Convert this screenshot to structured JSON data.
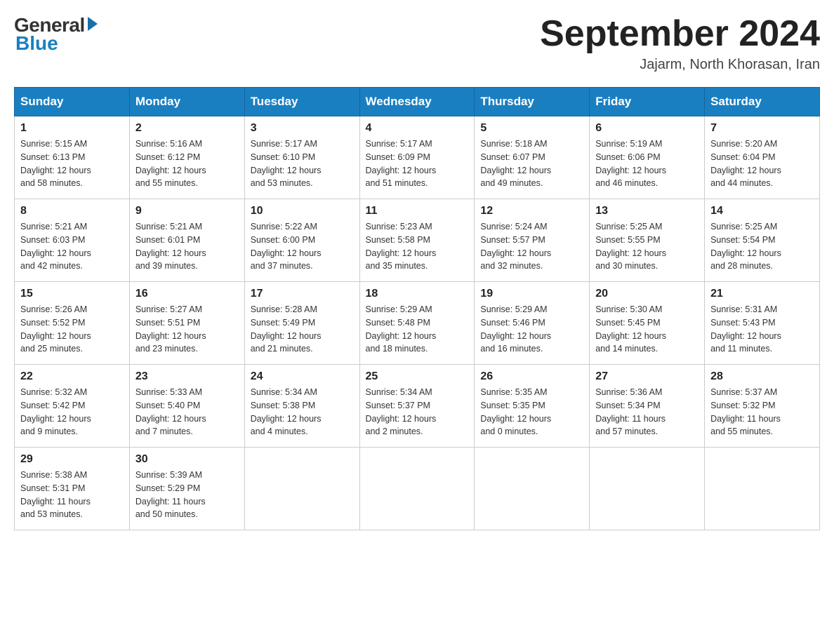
{
  "header": {
    "logo": {
      "general": "General",
      "blue": "Blue"
    },
    "title": "September 2024",
    "location": "Jajarm, North Khorasan, Iran"
  },
  "calendar": {
    "days_of_week": [
      "Sunday",
      "Monday",
      "Tuesday",
      "Wednesday",
      "Thursday",
      "Friday",
      "Saturday"
    ],
    "weeks": [
      [
        {
          "day": "1",
          "sunrise": "5:15 AM",
          "sunset": "6:13 PM",
          "daylight": "12 hours and 58 minutes."
        },
        {
          "day": "2",
          "sunrise": "5:16 AM",
          "sunset": "6:12 PM",
          "daylight": "12 hours and 55 minutes."
        },
        {
          "day": "3",
          "sunrise": "5:17 AM",
          "sunset": "6:10 PM",
          "daylight": "12 hours and 53 minutes."
        },
        {
          "day": "4",
          "sunrise": "5:17 AM",
          "sunset": "6:09 PM",
          "daylight": "12 hours and 51 minutes."
        },
        {
          "day": "5",
          "sunrise": "5:18 AM",
          "sunset": "6:07 PM",
          "daylight": "12 hours and 49 minutes."
        },
        {
          "day": "6",
          "sunrise": "5:19 AM",
          "sunset": "6:06 PM",
          "daylight": "12 hours and 46 minutes."
        },
        {
          "day": "7",
          "sunrise": "5:20 AM",
          "sunset": "6:04 PM",
          "daylight": "12 hours and 44 minutes."
        }
      ],
      [
        {
          "day": "8",
          "sunrise": "5:21 AM",
          "sunset": "6:03 PM",
          "daylight": "12 hours and 42 minutes."
        },
        {
          "day": "9",
          "sunrise": "5:21 AM",
          "sunset": "6:01 PM",
          "daylight": "12 hours and 39 minutes."
        },
        {
          "day": "10",
          "sunrise": "5:22 AM",
          "sunset": "6:00 PM",
          "daylight": "12 hours and 37 minutes."
        },
        {
          "day": "11",
          "sunrise": "5:23 AM",
          "sunset": "5:58 PM",
          "daylight": "12 hours and 35 minutes."
        },
        {
          "day": "12",
          "sunrise": "5:24 AM",
          "sunset": "5:57 PM",
          "daylight": "12 hours and 32 minutes."
        },
        {
          "day": "13",
          "sunrise": "5:25 AM",
          "sunset": "5:55 PM",
          "daylight": "12 hours and 30 minutes."
        },
        {
          "day": "14",
          "sunrise": "5:25 AM",
          "sunset": "5:54 PM",
          "daylight": "12 hours and 28 minutes."
        }
      ],
      [
        {
          "day": "15",
          "sunrise": "5:26 AM",
          "sunset": "5:52 PM",
          "daylight": "12 hours and 25 minutes."
        },
        {
          "day": "16",
          "sunrise": "5:27 AM",
          "sunset": "5:51 PM",
          "daylight": "12 hours and 23 minutes."
        },
        {
          "day": "17",
          "sunrise": "5:28 AM",
          "sunset": "5:49 PM",
          "daylight": "12 hours and 21 minutes."
        },
        {
          "day": "18",
          "sunrise": "5:29 AM",
          "sunset": "5:48 PM",
          "daylight": "12 hours and 18 minutes."
        },
        {
          "day": "19",
          "sunrise": "5:29 AM",
          "sunset": "5:46 PM",
          "daylight": "12 hours and 16 minutes."
        },
        {
          "day": "20",
          "sunrise": "5:30 AM",
          "sunset": "5:45 PM",
          "daylight": "12 hours and 14 minutes."
        },
        {
          "day": "21",
          "sunrise": "5:31 AM",
          "sunset": "5:43 PM",
          "daylight": "12 hours and 11 minutes."
        }
      ],
      [
        {
          "day": "22",
          "sunrise": "5:32 AM",
          "sunset": "5:42 PM",
          "daylight": "12 hours and 9 minutes."
        },
        {
          "day": "23",
          "sunrise": "5:33 AM",
          "sunset": "5:40 PM",
          "daylight": "12 hours and 7 minutes."
        },
        {
          "day": "24",
          "sunrise": "5:34 AM",
          "sunset": "5:38 PM",
          "daylight": "12 hours and 4 minutes."
        },
        {
          "day": "25",
          "sunrise": "5:34 AM",
          "sunset": "5:37 PM",
          "daylight": "12 hours and 2 minutes."
        },
        {
          "day": "26",
          "sunrise": "5:35 AM",
          "sunset": "5:35 PM",
          "daylight": "12 hours and 0 minutes."
        },
        {
          "day": "27",
          "sunrise": "5:36 AM",
          "sunset": "5:34 PM",
          "daylight": "11 hours and 57 minutes."
        },
        {
          "day": "28",
          "sunrise": "5:37 AM",
          "sunset": "5:32 PM",
          "daylight": "11 hours and 55 minutes."
        }
      ],
      [
        {
          "day": "29",
          "sunrise": "5:38 AM",
          "sunset": "5:31 PM",
          "daylight": "11 hours and 53 minutes."
        },
        {
          "day": "30",
          "sunrise": "5:39 AM",
          "sunset": "5:29 PM",
          "daylight": "11 hours and 50 minutes."
        },
        null,
        null,
        null,
        null,
        null
      ]
    ]
  }
}
